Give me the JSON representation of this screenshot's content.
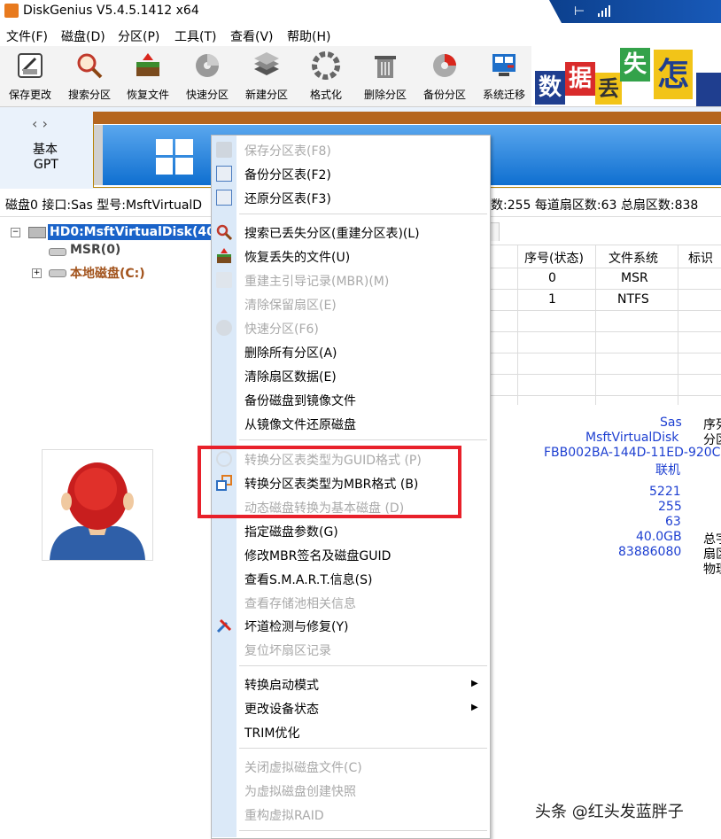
{
  "window": {
    "title": "DiskGenius V5.4.5.1412 x64"
  },
  "menubar": [
    "文件(F)",
    "磁盘(D)",
    "分区(P)",
    "工具(T)",
    "查看(V)",
    "帮助(H)"
  ],
  "toolbar": [
    {
      "label": "保存更改",
      "icon": "save-icon"
    },
    {
      "label": "搜索分区",
      "icon": "search-icon"
    },
    {
      "label": "恢复文件",
      "icon": "recover-icon"
    },
    {
      "label": "快速分区",
      "icon": "quick-partition-icon"
    },
    {
      "label": "新建分区",
      "icon": "new-partition-icon"
    },
    {
      "label": "格式化",
      "icon": "format-icon"
    },
    {
      "label": "删除分区",
      "icon": "delete-icon"
    },
    {
      "label": "备份分区",
      "icon": "backup-icon"
    },
    {
      "label": "系统迁移",
      "icon": "migrate-icon"
    }
  ],
  "banner": {
    "tiles": [
      "数",
      "据",
      "丢",
      "失",
      "怎"
    ]
  },
  "diskmap": {
    "kind": "基本",
    "style": "GPT"
  },
  "diskinfo": {
    "left": "磁盘0 接口:Sas  型号:MsftVirtualD",
    "right": "头数:255  每道扇区数:63  总扇区数:838"
  },
  "tree": {
    "disk": "HD0:MsftVirtualDisk(40G",
    "partitions": [
      "MSR(0)",
      "本地磁盘(C:)"
    ]
  },
  "table": {
    "headers": [
      "序号(状态)",
      "文件系统",
      "标识"
    ],
    "rows": [
      [
        "0",
        "MSR"
      ],
      [
        "1",
        "NTFS"
      ]
    ]
  },
  "details": {
    "values": [
      "Sas",
      "MsftVirtualDisk",
      "FBB002BA-144D-11ED-920C",
      "联机",
      "5221",
      "255",
      "63",
      "40.0GB",
      "83886080"
    ],
    "side_labels": [
      "序列",
      "分区",
      "总字",
      "扇区",
      "物理"
    ]
  },
  "context_menu": {
    "items": [
      {
        "label": "保存分区表(F8)",
        "disabled": true
      },
      {
        "label": "备份分区表(F2)",
        "disabled": false
      },
      {
        "label": "还原分区表(F3)",
        "disabled": false
      },
      {
        "label": "搜索已丢失分区(重建分区表)(L)",
        "disabled": false
      },
      {
        "label": "恢复丢失的文件(U)",
        "disabled": false
      },
      {
        "label": "重建主引导记录(MBR)(M)",
        "disabled": true
      },
      {
        "label": "清除保留扇区(E)",
        "disabled": true
      },
      {
        "label": "快速分区(F6)",
        "disabled": true
      },
      {
        "label": "删除所有分区(A)",
        "disabled": false
      },
      {
        "label": "清除扇区数据(E)",
        "disabled": false
      },
      {
        "label": "备份磁盘到镜像文件",
        "disabled": false
      },
      {
        "label": "从镜像文件还原磁盘",
        "disabled": false
      },
      {
        "label": "转换分区表类型为GUID格式 (P)",
        "disabled": true
      },
      {
        "label": "转换分区表类型为MBR格式 (B)",
        "disabled": false
      },
      {
        "label": "动态磁盘转换为基本磁盘 (D)",
        "disabled": true
      },
      {
        "label": "指定磁盘参数(G)",
        "disabled": false
      },
      {
        "label": "修改MBR签名及磁盘GUID",
        "disabled": false
      },
      {
        "label": "查看S.M.A.R.T.信息(S)",
        "disabled": false
      },
      {
        "label": "查看存储池相关信息",
        "disabled": true
      },
      {
        "label": "坏道检测与修复(Y)",
        "disabled": false
      },
      {
        "label": "复位坏扇区记录",
        "disabled": true
      },
      {
        "label": "转换启动模式",
        "disabled": false
      },
      {
        "label": "更改设备状态",
        "disabled": false
      },
      {
        "label": "TRIM优化",
        "disabled": false
      },
      {
        "label": "关闭虚拟磁盘文件(C)",
        "disabled": true
      },
      {
        "label": "为虚拟磁盘创建快照",
        "disabled": true
      },
      {
        "label": "重构虚拟RAID",
        "disabled": true
      }
    ]
  },
  "watermark": "头条 @红头发蓝胖子",
  "colors": {
    "highlight_box": "#e8202a",
    "partition_blue": "#0f6fd0",
    "menu_gutter": "#dbe9f8"
  }
}
